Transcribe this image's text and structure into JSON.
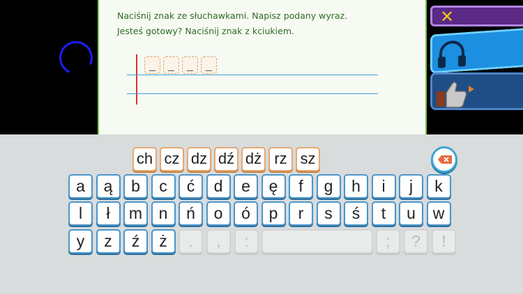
{
  "instructions": {
    "line1": "Naciśnij znak ze słuchawkami. Napisz podany wyraz.",
    "line2": "Jesteś gotowy? Naciśnij znak z kciukiem."
  },
  "blanks": [
    "_",
    "_",
    "_",
    "_"
  ],
  "side_buttons": {
    "close_icon": "✕",
    "listen_icon": "headphones-icon",
    "ready_icon": "thumbs-up-icon"
  },
  "keyboard": {
    "digraphs": [
      "ch",
      "cz",
      "dz",
      "dź",
      "dż",
      "rz",
      "sz"
    ],
    "row1": [
      "a",
      "ą",
      "b",
      "c",
      "ć",
      "d",
      "e",
      "ę",
      "f",
      "g",
      "h",
      "i",
      "j",
      "k"
    ],
    "row2": [
      "l",
      "ł",
      "m",
      "n",
      "ń",
      "o",
      "ó",
      "p",
      "r",
      "s",
      "ś",
      "t",
      "u",
      "w"
    ],
    "row3": [
      "y",
      "z",
      "ź",
      "ż"
    ],
    "punct_left": [
      ".",
      ",",
      ":"
    ],
    "punct_right": [
      ";",
      "?",
      "!"
    ]
  },
  "colors": {
    "accent": "#7cc44a",
    "key_border": "#4b95c9",
    "digraph_border": "#e4a872"
  }
}
